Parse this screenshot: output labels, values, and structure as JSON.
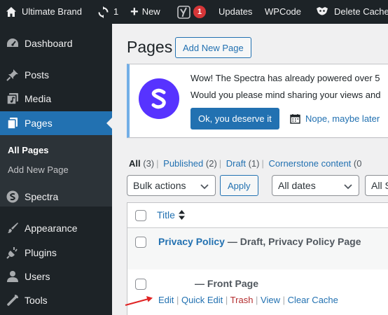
{
  "admin_bar": {
    "site_name": "Ultimate Brand",
    "updates_count": "1",
    "new_label": "New",
    "yoast_badge": "1",
    "updates_label": "Updates",
    "wpcode_label": "WPCode",
    "delete_cache_label": "Delete Cache"
  },
  "sidebar": {
    "dashboard": "Dashboard",
    "posts": "Posts",
    "media": "Media",
    "pages": "Pages",
    "all_pages": "All Pages",
    "add_new_page": "Add New Page",
    "spectra": "Spectra",
    "appearance": "Appearance",
    "plugins": "Plugins",
    "users": "Users",
    "tools": "Tools"
  },
  "main": {
    "title": "Pages",
    "add_new_button": "Add New Page"
  },
  "notice": {
    "line1": "Wow! The Spectra has already powered over 5",
    "line2": "Would you please mind sharing your views and",
    "accept_button": "Ok, you deserve it",
    "decline_link": "Nope, maybe later"
  },
  "filters": {
    "all_label": "All",
    "all_count": "(3)",
    "published_label": "Published",
    "published_count": "(2)",
    "draft_label": "Draft",
    "draft_count": "(1)",
    "cornerstone_label": "Cornerstone content",
    "cornerstone_count": "(0"
  },
  "toolbar": {
    "bulk_actions": "Bulk actions",
    "apply": "Apply",
    "all_dates": "All dates",
    "all_seo": "All S"
  },
  "table": {
    "column_title": "Title",
    "rows": [
      {
        "title_link": "Privacy Policy",
        "state": " — Draft, Privacy Policy Page"
      },
      {
        "title_link": "",
        "state": "— Front Page"
      }
    ],
    "row_actions": {
      "edit": "Edit",
      "quick_edit": "Quick Edit",
      "trash": "Trash",
      "view": "View",
      "clear_cache": "Clear Cache"
    }
  },
  "colors": {
    "admin_bar_bg": "#1d2327",
    "accent": "#2271b1",
    "spectra_purple": "#5733ff",
    "badge_red": "#d63638",
    "annotation_arrow": "#e02424"
  }
}
